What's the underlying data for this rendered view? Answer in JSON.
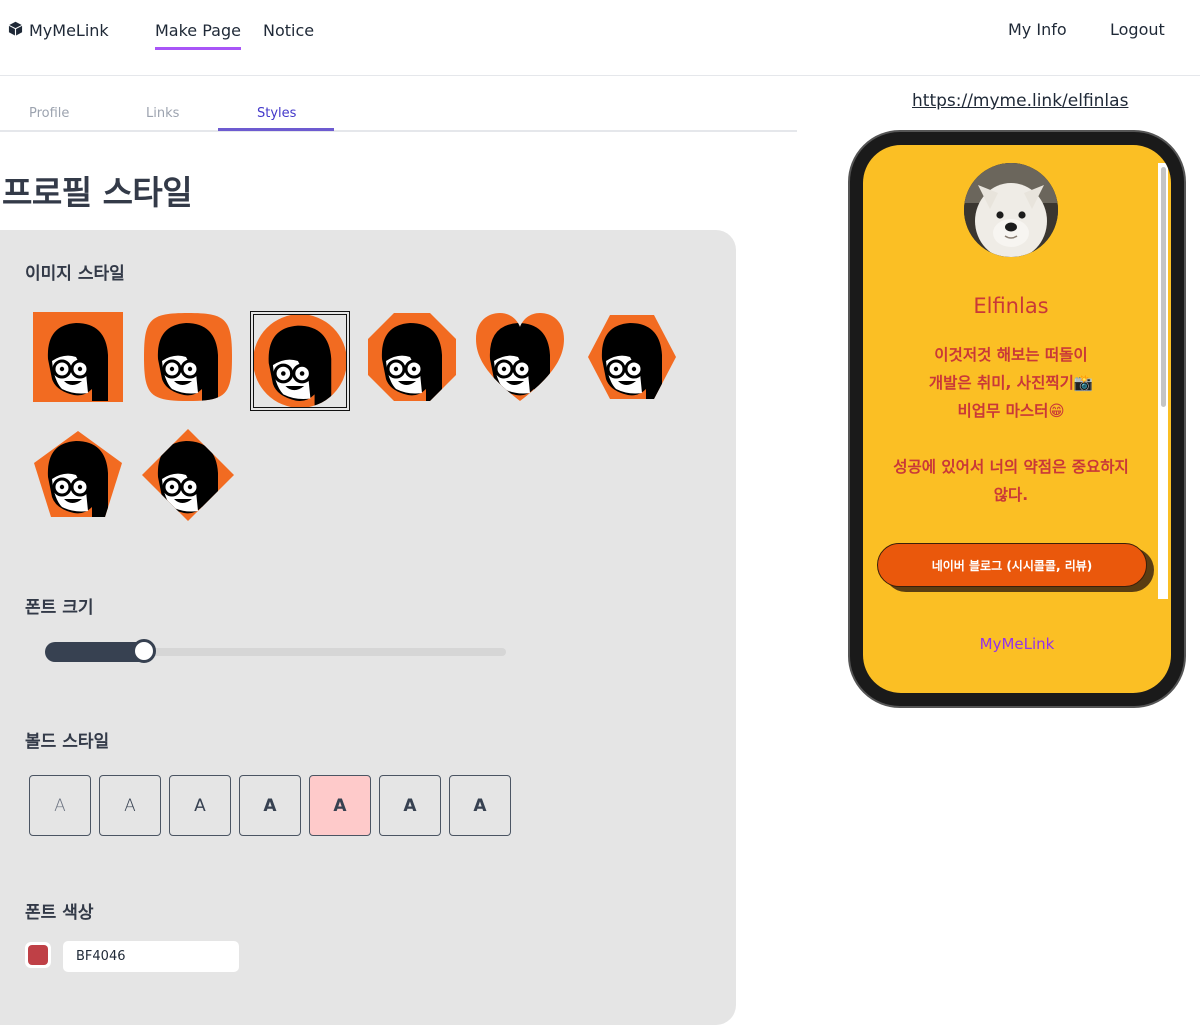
{
  "header": {
    "brand": "MyMeLink",
    "nav": {
      "make_page": "Make Page",
      "notice": "Notice"
    },
    "user": {
      "my_info": "My Info",
      "logout": "Logout"
    }
  },
  "tabs": {
    "profile": "Profile",
    "links": "Links",
    "styles": "Styles",
    "active": "Styles"
  },
  "page_title": "프로필 스타일",
  "image_style": {
    "label": "이미지 스타일",
    "shapes": [
      "square",
      "squircle",
      "circle",
      "octagon",
      "heart",
      "hexagon",
      "pentagon",
      "diamond"
    ],
    "selected": "circle",
    "shape_color": "#f26b21"
  },
  "font_size": {
    "label": "폰트 크기",
    "value_fraction": 0.21
  },
  "bold_style": {
    "label": "볼드 스타일",
    "options": [
      "A",
      "A",
      "A",
      "A",
      "A",
      "A",
      "A"
    ],
    "selected_index": 4
  },
  "font_color": {
    "label": "폰트 색상",
    "value": "BF4046",
    "swatch": "#bf4046"
  },
  "preview": {
    "url": "https://myme.link/elfinlas",
    "name": "Elfinlas",
    "bio": [
      "이것저것 해보는 떠돌이",
      "개발은 취미, 사진찍기📸",
      "비업무 마스터😁",
      "",
      "성공에 있어서 너의 약점은 중요하지",
      "않다."
    ],
    "link_button": "네이버 블로그 (시시콜콜, 리뷰)",
    "footer": "MyMeLink",
    "background": "#fbbf24",
    "text_color": "#c93838",
    "button_color": "#ea580c"
  }
}
